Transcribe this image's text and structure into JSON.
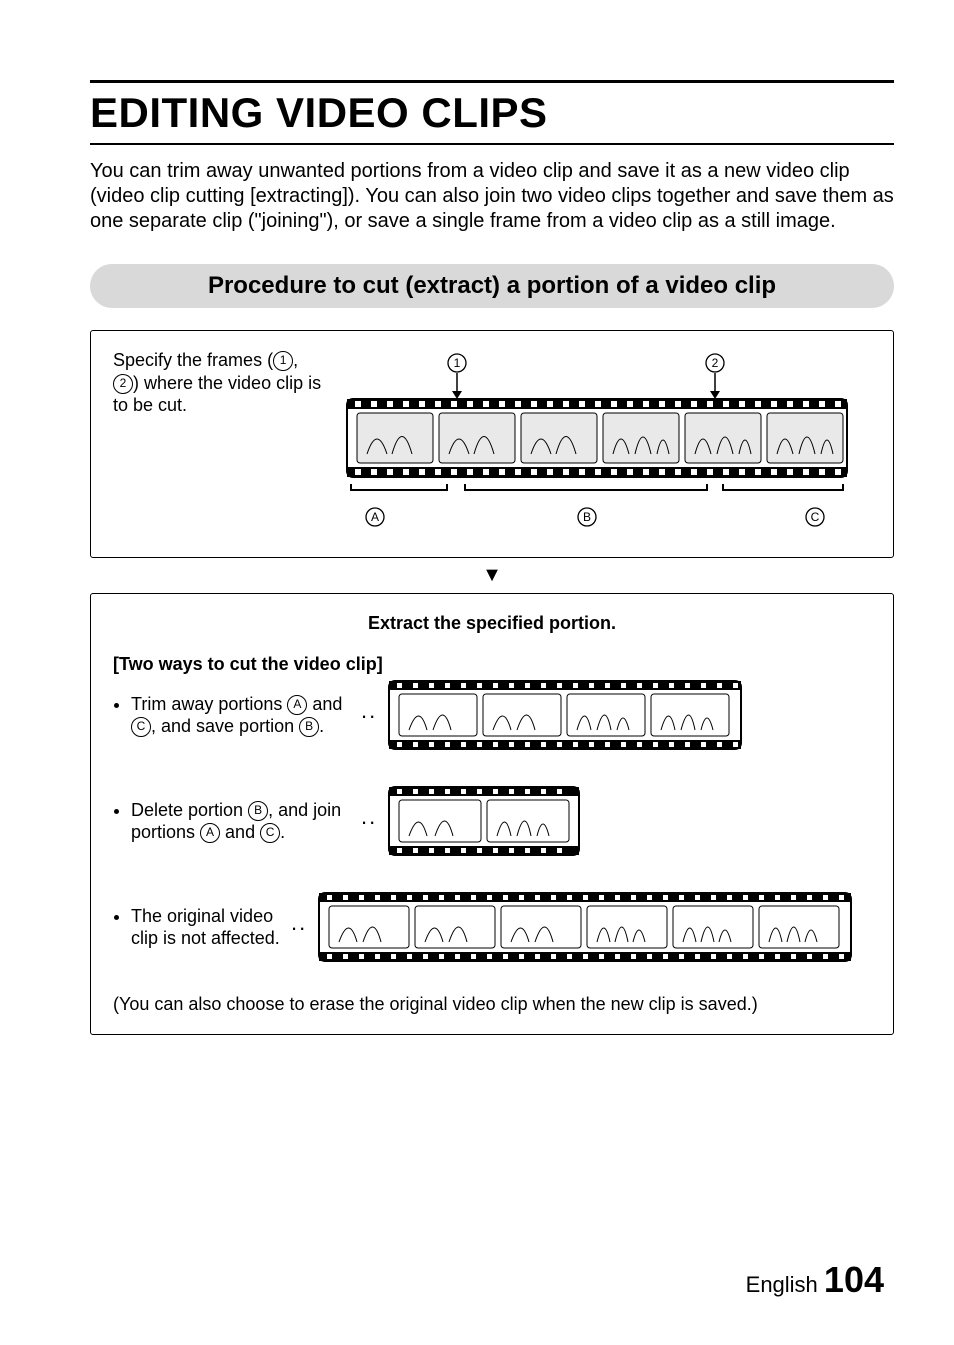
{
  "title": "EDITING VIDEO CLIPS",
  "intro": "You can trim away unwanted portions from a video clip and save it as a new video clip (video clip cutting [extracting]). You can also join two video clips together and save them as one separate clip (\"joining\"), or save a single frame from a video clip as a still image.",
  "section_heading": "Procedure to cut (extract) a portion of a video clip",
  "step1": {
    "text_pre": "Specify the frames (",
    "mark1": "1",
    "mark2": "2",
    "text_post": ") where the video clip is to be cut.",
    "labels": {
      "one": "1",
      "two": "2",
      "A": "A",
      "B": "B",
      "C": "C"
    }
  },
  "arrow": "▼",
  "extract_heading": "Extract the specified portion.",
  "two_ways_title": "[Two ways to cut the video clip]",
  "bullet1_pre": "Trim away portions ",
  "bullet1_mid": " and ",
  "bullet1_end": ", and save portion ",
  "bullet1_tail": ".",
  "bullet2_pre": "Delete portion ",
  "bullet2_mid": ", and join portions ",
  "bullet2_and": " and ",
  "bullet2_tail": ".",
  "bullet3": "The original video clip is not affected.",
  "note": "(You can also choose to erase the original video clip when the new clip is saved.)",
  "page_label": "English",
  "page_number": "104",
  "marks": {
    "A": "A",
    "B": "B",
    "C": "C"
  },
  "dots": ".."
}
